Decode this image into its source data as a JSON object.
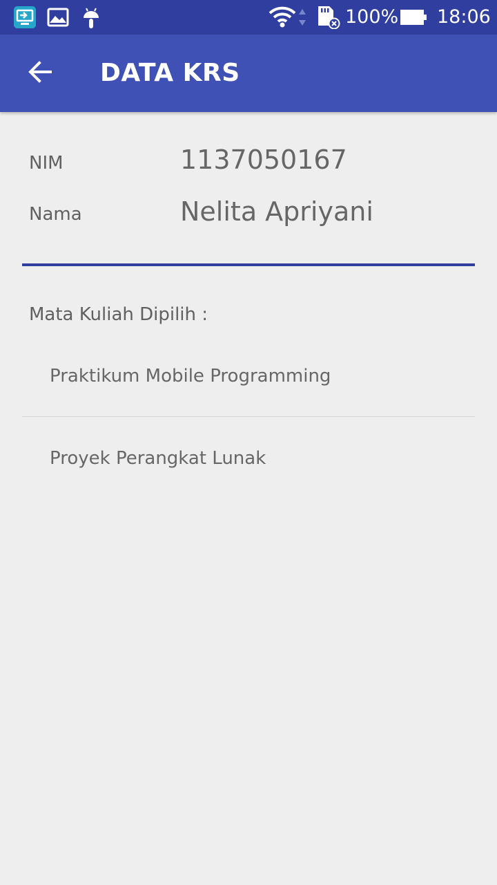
{
  "status_bar": {
    "battery_text": "100%",
    "time": "18:06",
    "icons": [
      "screen-share-icon",
      "image-icon",
      "android-icon",
      "wifi-icon",
      "sd-card-icon",
      "battery-icon"
    ]
  },
  "app_bar": {
    "title": "DATA KRS",
    "back_icon": "arrow-back-icon"
  },
  "student": {
    "nim_label": "NIM",
    "nim_value": "1137050167",
    "name_label": "Nama",
    "name_value": "Nelita Apriyani"
  },
  "courses": {
    "header": "Mata Kuliah Dipilih :",
    "items": [
      {
        "label": "Praktikum Mobile Programming"
      },
      {
        "label": "Proyek Perangkat Lunak"
      }
    ]
  },
  "colors": {
    "status_bar": "#303f9f",
    "app_bar": "#3f51b5",
    "background": "#eeeeee",
    "accent_divider": "#303f9f"
  }
}
